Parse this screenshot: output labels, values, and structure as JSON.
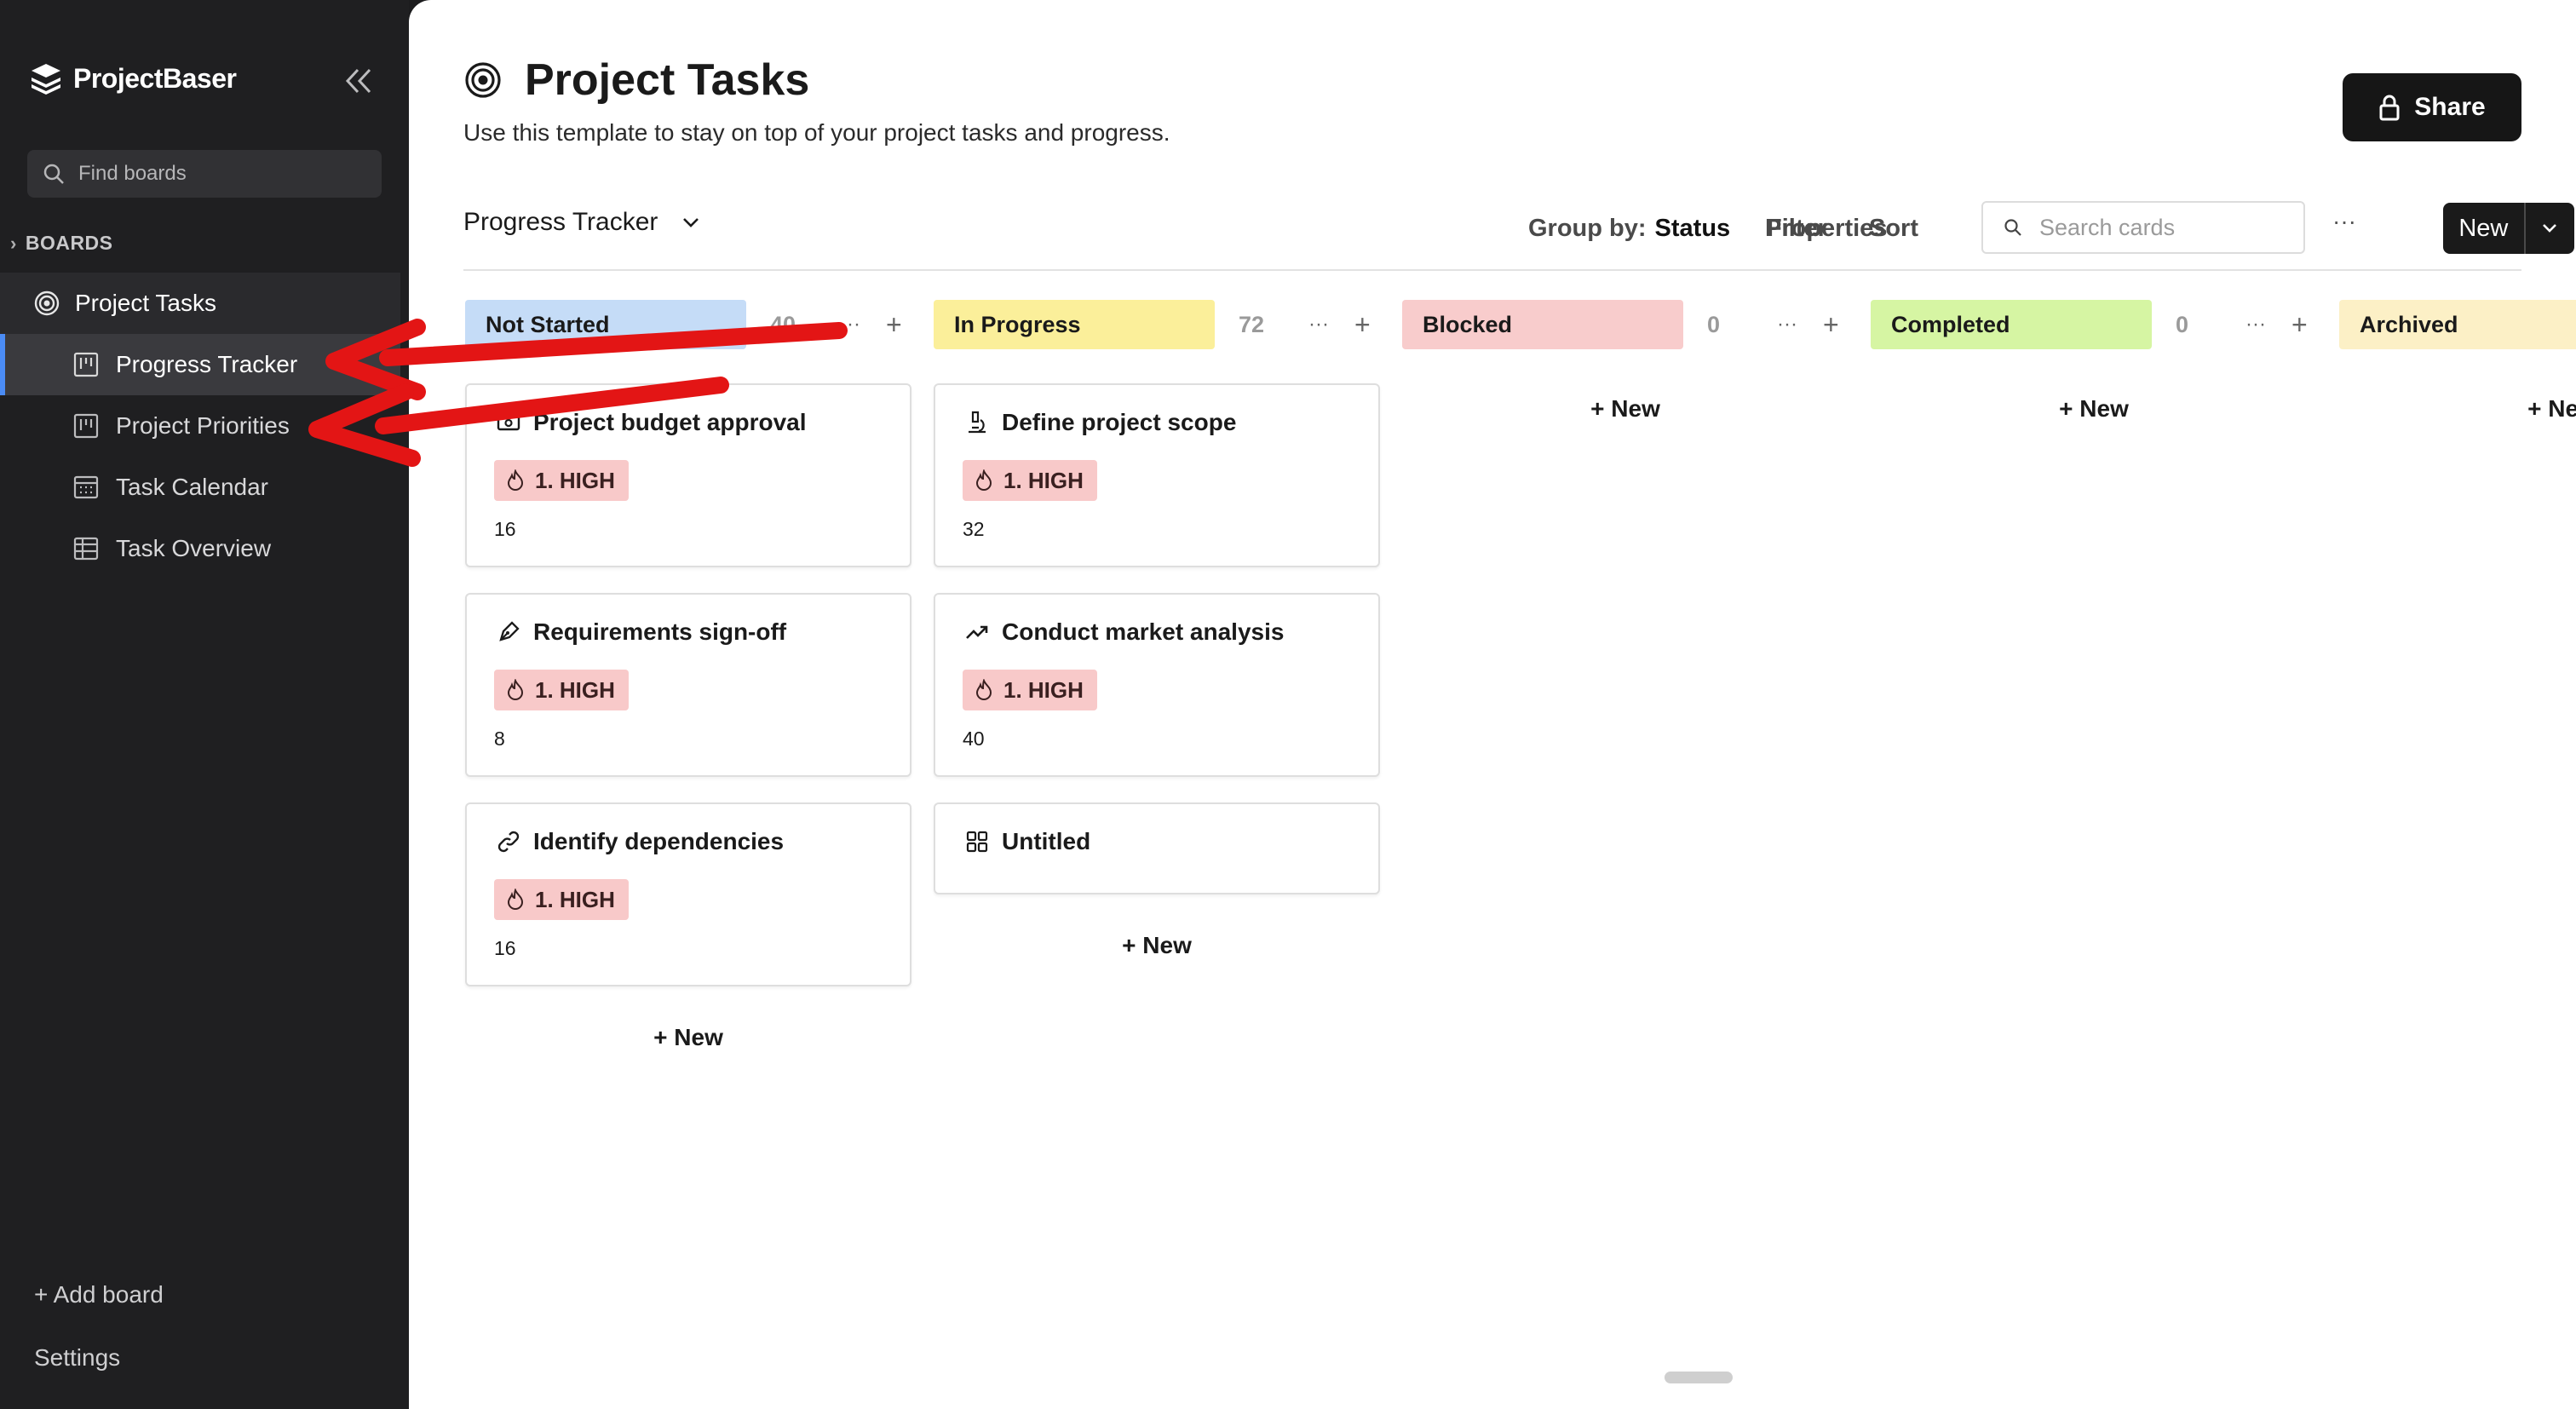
{
  "brand": {
    "name": "ProjectBaser"
  },
  "sidebar": {
    "search_placeholder": "Find boards",
    "section": "BOARDS",
    "root": {
      "label": "Project Tasks"
    },
    "items": [
      {
        "label": "Progress Tracker",
        "icon": "board-icon",
        "active": true
      },
      {
        "label": "Project Priorities",
        "icon": "board-icon",
        "active": false
      },
      {
        "label": "Task Calendar",
        "icon": "calendar-icon",
        "active": false
      },
      {
        "label": "Task Overview",
        "icon": "table-icon",
        "active": false
      }
    ],
    "add_board": "+ Add board",
    "settings": "Settings"
  },
  "header": {
    "title": "Project Tasks",
    "subtitle": "Use this template to stay on top of your project tasks and progress.",
    "share": "Share"
  },
  "toolbar": {
    "view": "Progress Tracker",
    "properties": "Properties",
    "group_by_label": "Group by:",
    "group_by_value": "Status",
    "filter": "Filter",
    "sort": "Sort",
    "search_placeholder": "Search cards",
    "more": "···",
    "new": "New"
  },
  "board": {
    "add_new": "+ New",
    "columns": [
      {
        "name": "Not Started",
        "count": "40",
        "color": "#c5dcf7",
        "cards": [
          {
            "title": "Project budget approval",
            "icon": "money-icon",
            "priority": "1. HIGH",
            "value": "16"
          },
          {
            "title": "Requirements sign-off",
            "icon": "pen-icon",
            "priority": "1. HIGH",
            "value": "8"
          },
          {
            "title": "Identify dependencies",
            "icon": "link-icon",
            "priority": "1. HIGH",
            "value": "16"
          }
        ]
      },
      {
        "name": "In Progress",
        "count": "72",
        "color": "#fbef9a",
        "cards": [
          {
            "title": "Define project scope",
            "icon": "microscope-icon",
            "priority": "1. HIGH",
            "value": "32"
          },
          {
            "title": "Conduct market analysis",
            "icon": "trend-icon",
            "priority": "1. HIGH",
            "value": "40"
          },
          {
            "title": "Untitled",
            "icon": "grid-icon"
          }
        ]
      },
      {
        "name": "Blocked",
        "count": "0",
        "color": "#f8cccc",
        "cards": []
      },
      {
        "name": "Completed",
        "count": "0",
        "color": "#d6f5a3",
        "cards": []
      },
      {
        "name": "Archived",
        "color": "#fcf0c6",
        "cards": []
      }
    ]
  },
  "colors": {
    "sidebar": "#1f1f21",
    "accent": "#4b8cf5",
    "priority_high": "#f8c9c9",
    "annotation": "#e31515"
  }
}
